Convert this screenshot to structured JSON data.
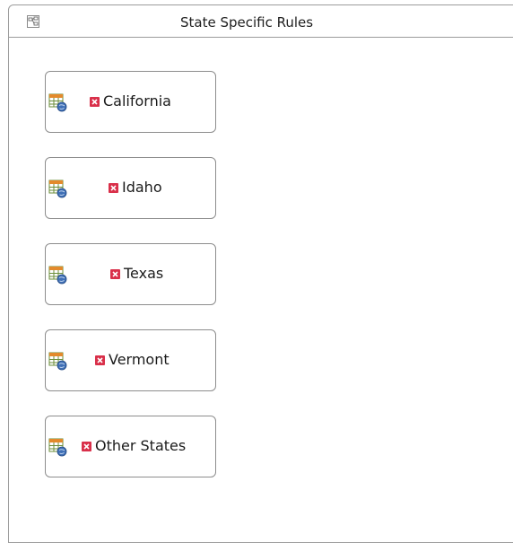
{
  "panel": {
    "title": "State Specific Rules",
    "icon": "diagram-icon"
  },
  "rules": [
    {
      "label": "California",
      "icon": "decision-table-icon",
      "status_icon": "error-icon"
    },
    {
      "label": "Idaho",
      "icon": "decision-table-icon",
      "status_icon": "error-icon"
    },
    {
      "label": "Texas",
      "icon": "decision-table-icon",
      "status_icon": "error-icon"
    },
    {
      "label": "Vermont",
      "icon": "decision-table-icon",
      "status_icon": "error-icon"
    },
    {
      "label": "Other States",
      "icon": "decision-table-icon",
      "status_icon": "error-icon"
    }
  ],
  "colors": {
    "border": "#9c9c9c",
    "error_fill": "#d9304a",
    "table_header": "#e38a2c",
    "table_grid": "#6b8e3a",
    "globe": "#3f6fb6"
  }
}
